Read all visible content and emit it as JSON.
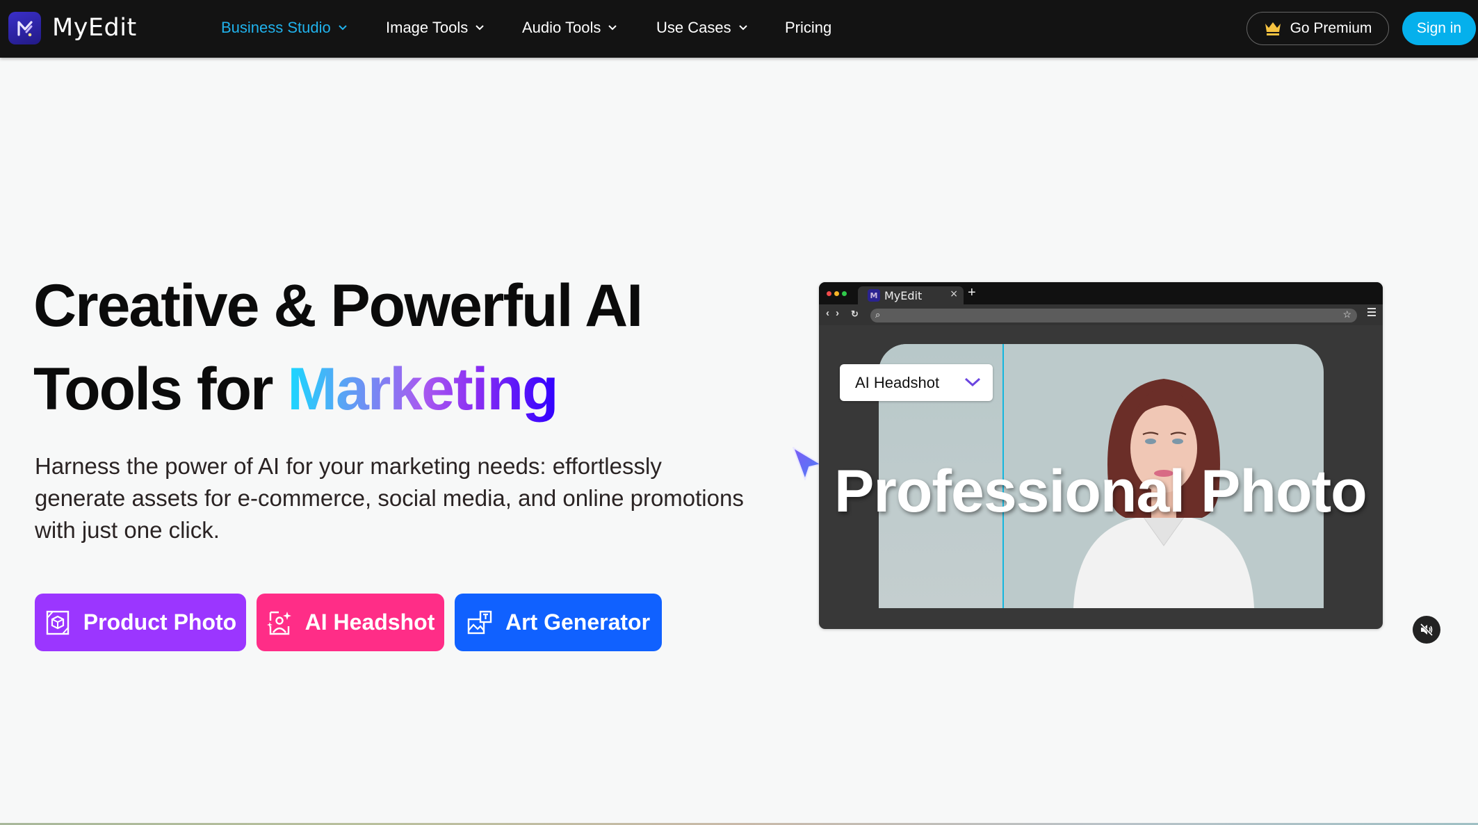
{
  "nav": {
    "brand": "MyEdit",
    "items": [
      {
        "label": "Business Studio",
        "has_dropdown": true,
        "active": true
      },
      {
        "label": "Image Tools",
        "has_dropdown": true,
        "active": false
      },
      {
        "label": "Audio Tools",
        "has_dropdown": true,
        "active": false
      },
      {
        "label": "Use Cases",
        "has_dropdown": true,
        "active": false
      },
      {
        "label": "Pricing",
        "has_dropdown": false,
        "active": false
      }
    ],
    "premium_label": "Go Premium",
    "signin_label": "Sign in"
  },
  "hero": {
    "title_line1": "Creative & Powerful AI",
    "title_line2_prefix": "Tools for ",
    "title_highlight": "Marketing",
    "description": "Harness the power of AI for your marketing needs: effortlessly generate assets for e-commerce, social media, and online promotions with just one click.",
    "buttons": [
      {
        "label": "Product Photo",
        "icon": "product-photo-icon",
        "color": "#9b36ff"
      },
      {
        "label": "AI Headshot",
        "icon": "ai-headshot-icon",
        "color": "#ff2d87"
      },
      {
        "label": "Art Generator",
        "icon": "art-generator-icon",
        "color": "#1061ff"
      }
    ]
  },
  "demo_video": {
    "browser_tab_title": "MyEdit",
    "tab_logo_letter": "M",
    "dropdown_selected": "AI Headshot",
    "overlay_text": "Professional Photo",
    "muted": true
  },
  "colors": {
    "nav_bg": "#131313",
    "accent_blue": "#05b0ec",
    "active_nav": "#20b2ec",
    "page_bg": "#f7f8f8"
  }
}
